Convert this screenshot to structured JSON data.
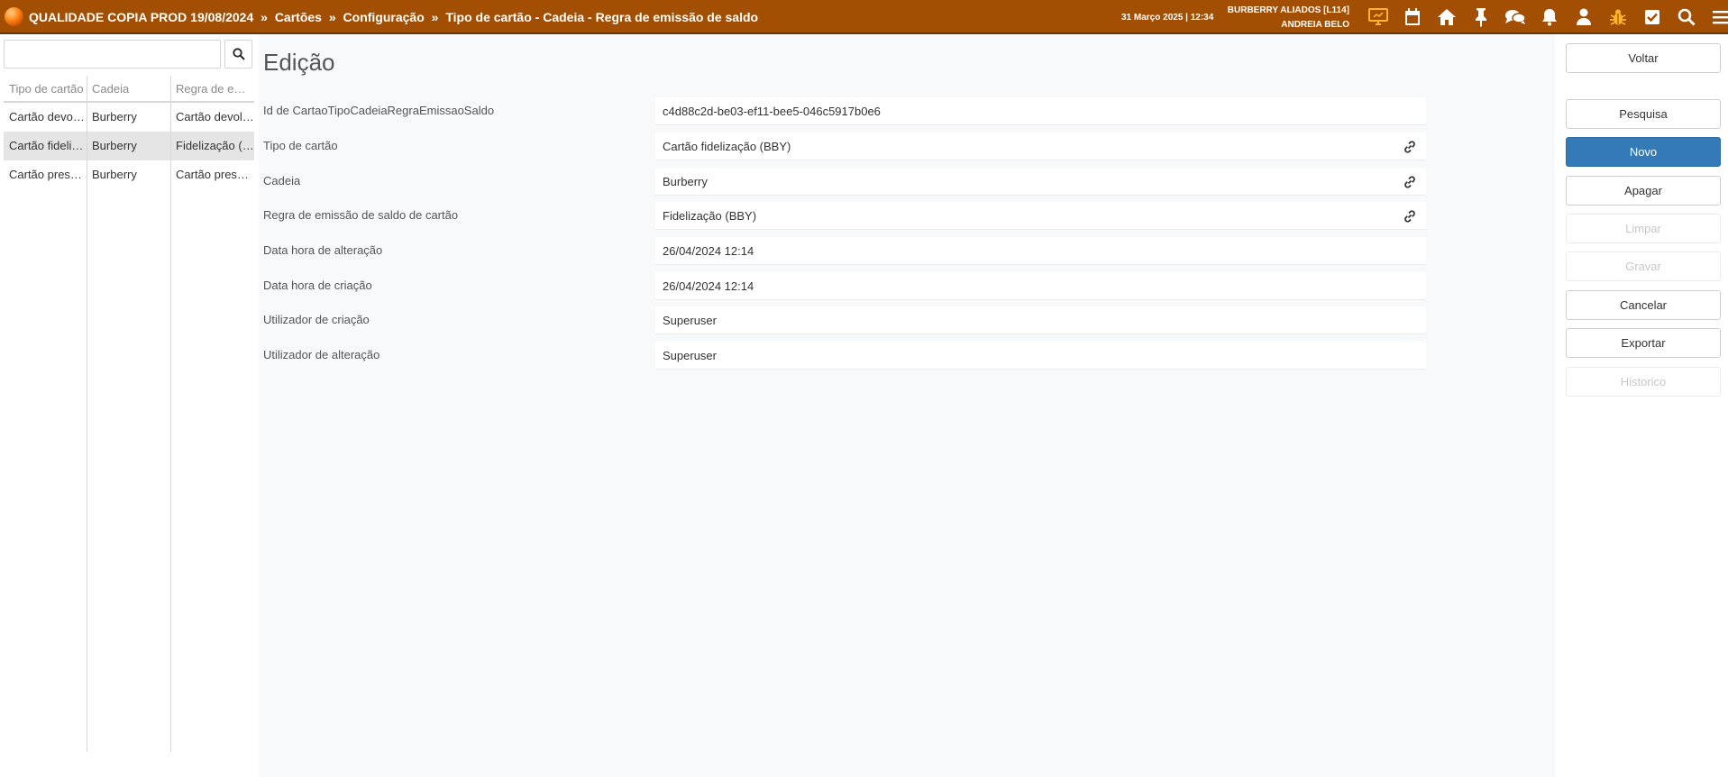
{
  "header": {
    "breadcrumb": [
      "QUALIDADE COPIA PROD 19/08/2024",
      "Cartões",
      "Configuração",
      "Tipo de cartão - Cadeia - Regra de emissão de saldo"
    ],
    "separator": "»",
    "datetime": "31 Março 2025 | 12:34",
    "company": "BURBERRY ALIADOS [L114]",
    "user": "ANDREIA BELO",
    "icons": [
      "monitor-icon",
      "calendar-icon",
      "home-icon",
      "pin-icon",
      "chat-icon",
      "bell-icon",
      "user-icon",
      "bug-icon",
      "checkbox-icon",
      "search-icon",
      "menu-icon"
    ]
  },
  "list": {
    "search_placeholder": "",
    "columns": [
      "Tipo de cartão",
      "Cadeia",
      "Regra de emissão de saldo"
    ],
    "rows": [
      [
        "Cartão devolução",
        "Burberry",
        "Cartão devolução"
      ],
      [
        "Cartão fidelização (BBY)",
        "Burberry",
        "Fidelização (BBY)"
      ],
      [
        "Cartão presente",
        "Burberry",
        "Cartão presente"
      ]
    ],
    "selected_row": 1
  },
  "form": {
    "title": "Edição",
    "fields": [
      {
        "label": "Id de CartaoTipoCadeiaRegraEmissaoSaldo",
        "value": "c4d88c2d-be03-ef11-bee5-046c5917b0e6",
        "link": false
      },
      {
        "label": "Tipo de cartão",
        "value": "Cartão fidelização (BBY)",
        "link": true
      },
      {
        "label": "Cadeia",
        "value": "Burberry",
        "link": true
      },
      {
        "label": "Regra de emissão de saldo de cartão",
        "value": "Fidelização (BBY)",
        "link": true
      },
      {
        "label": "Data hora de alteração",
        "value": "26/04/2024 12:14",
        "link": false
      },
      {
        "label": "Data hora de criação",
        "value": "26/04/2024 12:14",
        "link": false
      },
      {
        "label": "Utilizador de criação",
        "value": "Superuser",
        "link": false
      },
      {
        "label": "Utilizador de alteração",
        "value": "Superuser",
        "link": false
      }
    ]
  },
  "actions": {
    "voltar": "Voltar",
    "pesquisa": "Pesquisa",
    "novo": "Novo",
    "apagar": "Apagar",
    "limpar": "Limpar",
    "gravar": "Gravar",
    "cancelar": "Cancelar",
    "exportar": "Exportar",
    "historico": "Historico"
  },
  "colors": {
    "header_bg": "#a34f03",
    "primary": "#337ab7",
    "icon_accent": "#ffb42a"
  }
}
